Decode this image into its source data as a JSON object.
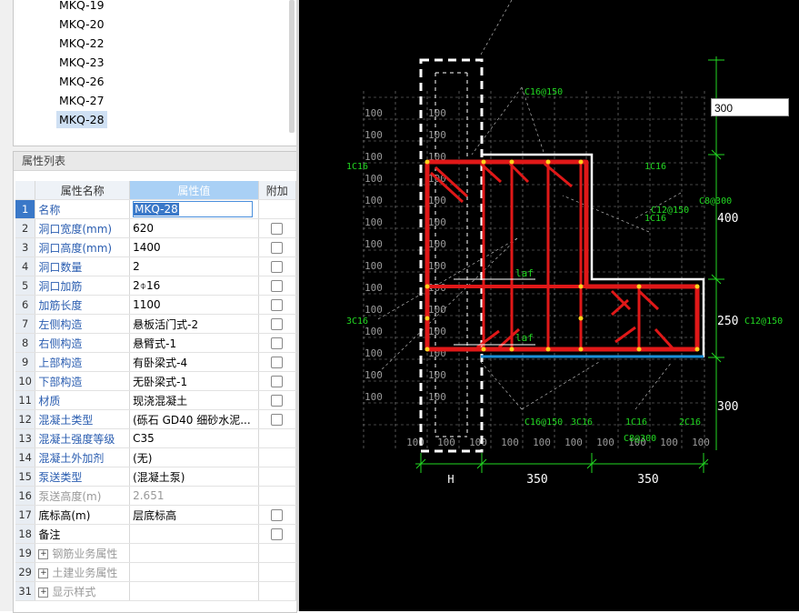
{
  "tree": {
    "items": [
      "MKQ-19",
      "MKQ-20",
      "MKQ-22",
      "MKQ-23",
      "MKQ-26",
      "MKQ-27",
      "MKQ-28"
    ],
    "selected": "MKQ-28"
  },
  "props": {
    "title": "属性列表",
    "headers": {
      "name": "属性名称",
      "value": "属性值",
      "extra": "附加"
    },
    "rows": [
      {
        "idx": "1",
        "name": "名称",
        "value": "MKQ-28"
      },
      {
        "idx": "2",
        "name": "洞口宽度(mm)",
        "value": "620"
      },
      {
        "idx": "3",
        "name": "洞口高度(mm)",
        "value": "1400"
      },
      {
        "idx": "4",
        "name": "洞口数量",
        "value": "2"
      },
      {
        "idx": "5",
        "name": "洞口加筋",
        "value": "2⌽16"
      },
      {
        "idx": "6",
        "name": "加筋长度",
        "value": "1100"
      },
      {
        "idx": "7",
        "name": "左侧构造",
        "value": "悬板活门式-2"
      },
      {
        "idx": "8",
        "name": "右侧构造",
        "value": "悬臂式-1"
      },
      {
        "idx": "9",
        "name": "上部构造",
        "value": "有卧梁式-4"
      },
      {
        "idx": "10",
        "name": "下部构造",
        "value": "无卧梁式-1"
      },
      {
        "idx": "11",
        "name": "材质",
        "value": "现浇混凝土"
      },
      {
        "idx": "12",
        "name": "混凝土类型",
        "value": "(砾石 GD40 细砂水泥..."
      },
      {
        "idx": "13",
        "name": "混凝土强度等级",
        "value": "C35"
      },
      {
        "idx": "14",
        "name": "混凝土外加剂",
        "value": "(无)"
      },
      {
        "idx": "15",
        "name": "泵送类型",
        "value": "(混凝土泵)"
      },
      {
        "idx": "16",
        "name": "泵送高度(m)",
        "value": "2.651"
      },
      {
        "idx": "17",
        "name": "底标高(m)",
        "value": "层底标高"
      },
      {
        "idx": "18",
        "name": "备注",
        "value": ""
      },
      {
        "idx": "19",
        "name": "钢筋业务属性",
        "value": ""
      },
      {
        "idx": "29",
        "name": "土建业务属性",
        "value": ""
      },
      {
        "idx": "31",
        "name": "显示样式",
        "value": ""
      }
    ]
  },
  "canvas": {
    "dim_input_value": "300",
    "labels": {
      "c16_150_top": "C16@150",
      "c16_150_bottom": "C16@150",
      "c12_150_a": "C12@150",
      "c12_150_b": "C12@150",
      "c8_300_a": "C8@300",
      "c8_300_b": "C8@300",
      "l_1c16_left": "1C16",
      "l_1c16_right": "1C16",
      "l_1c16_mid": "1C16",
      "l_1c16_bottom": "1C16",
      "l_3c16_left": "3C16",
      "l_3c16_bottom": "3C16",
      "l_2c16_bottom": "2C16",
      "laf_top": "laf",
      "laf_bottom": "laf",
      "dim_400": "400",
      "dim_250": "250",
      "dim_300": "300",
      "dim_h": "H",
      "dim_350_a": "350",
      "dim_350_b": "350",
      "grid": "100"
    },
    "colors": {
      "rebar": "#e01818",
      "outline": "#ffffff",
      "bottom_bar": "#1c8fd8",
      "green": "#22d822",
      "grid": "#8a8a8a"
    }
  }
}
